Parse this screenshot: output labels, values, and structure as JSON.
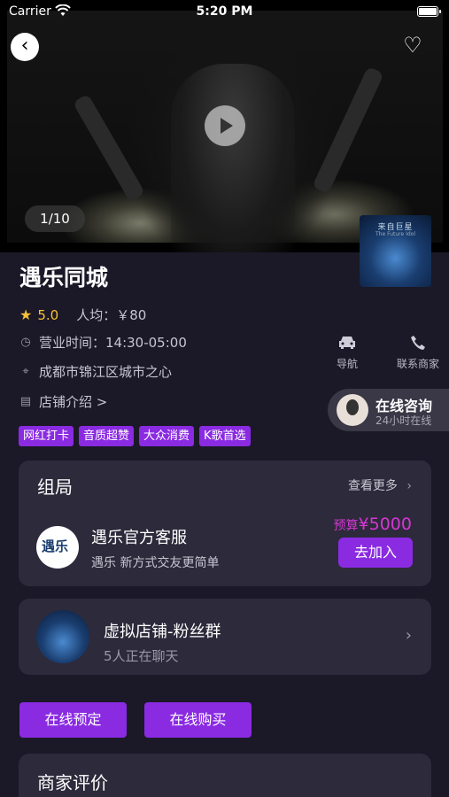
{
  "status_bar": {
    "carrier": "Carrier",
    "time": "5:20 PM"
  },
  "hero": {
    "counter": "1/10",
    "thumb_title": "来自巨星",
    "thumb_subtitle": "The Future Idol"
  },
  "shop": {
    "name": "遇乐同城",
    "rating": "5.0",
    "per_capita": "人均：￥80",
    "hours": "营业时间：14:30-05:00",
    "address": "成都市锦江区城市之心",
    "intro": "店铺介绍 >",
    "tags": [
      "网红打卡",
      "音质超赞",
      "大众消费",
      "K歌首选"
    ]
  },
  "actions": {
    "navigate": "导航",
    "contact": "联系商家"
  },
  "consult": {
    "title": "在线咨询",
    "subtitle": "24小时在线"
  },
  "group_card": {
    "title": "组局",
    "more": "查看更多",
    "name": "遇乐官方客服",
    "desc": "遇乐 新方式交友更简单",
    "budget_prefix": "预算",
    "budget_value": "¥5000",
    "join": "去加入"
  },
  "fans_card": {
    "name": "虚拟店铺-粉丝群",
    "count": "5人正在聊天"
  },
  "buttons": {
    "book": "在线预定",
    "buy": "在线购买"
  },
  "review": {
    "title": "商家评价"
  },
  "colors": {
    "accent": "#8a2be2",
    "budget": "#d437d4",
    "star": "#f7c236",
    "background": "#1b1827",
    "card": "#2d2a3b"
  },
  "icons": {
    "back": "back-arrow-icon",
    "favorite": "heart-icon",
    "play": "play-icon",
    "star": "star-icon",
    "clock": "clock-icon",
    "location": "location-pin-icon",
    "document": "document-icon",
    "car": "car-icon",
    "phone": "phone-icon",
    "chevron": "chevron-right-icon"
  }
}
